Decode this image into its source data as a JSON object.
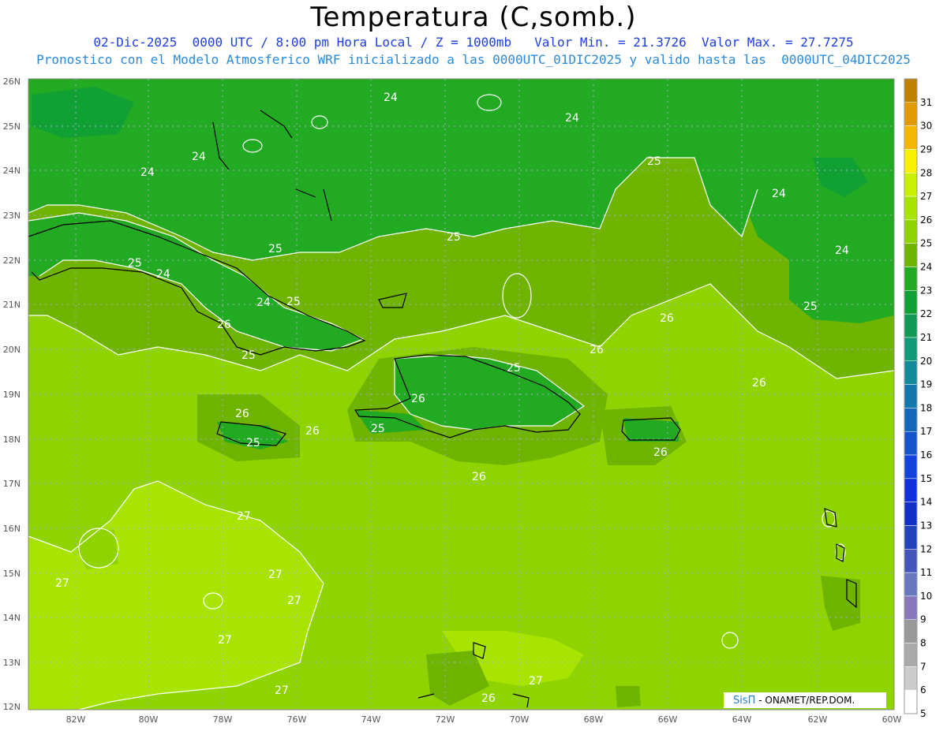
{
  "header": {
    "title": "Temperatura (C,somb.)",
    "line1": "02-Dic-2025  0000 UTC / 8:00 pm Hora Local / Z = 1000mb   Valor Min. = 21.3726  Valor Max. = 27.7275",
    "line2": "Pronostico con el Modelo Atmosferico WRF inicializado a las 0000UTC_01DIC2025 y valido hasta las  0000UTC_04DIC2025"
  },
  "axes": {
    "lat_labels": [
      "26N",
      "25N",
      "24N",
      "23N",
      "22N",
      "21N",
      "20N",
      "19N",
      "18N",
      "17N",
      "16N",
      "15N",
      "14N",
      "13N",
      "12N"
    ],
    "lon_labels": [
      "82W",
      "80W",
      "78W",
      "76W",
      "74W",
      "72W",
      "70W",
      "68W",
      "66W",
      "64W",
      "62W",
      "60W"
    ]
  },
  "colorbar": {
    "values": [
      "31",
      "30",
      "29",
      "28",
      "27",
      "26",
      "25",
      "24",
      "23",
      "22",
      "21",
      "20",
      "19",
      "18",
      "17",
      "16",
      "15",
      "14",
      "13",
      "12",
      "11",
      "10",
      "9",
      "8",
      "7",
      "6",
      "5"
    ],
    "colors": [
      "#c08000",
      "#e09a00",
      "#f5b800",
      "#f8f000",
      "#c8f000",
      "#a8e400",
      "#8fd400",
      "#6fb400",
      "#22aa22",
      "#11a033",
      "#129a55",
      "#129a77",
      "#138a99",
      "#1277aa",
      "#1466bb",
      "#1455cc",
      "#1244dd",
      "#1030dd",
      "#1030c8",
      "#2244bb",
      "#4455bb",
      "#6677bb",
      "#8877bb",
      "#999999",
      "#aaaaaa",
      "#cccccc",
      "#ffffff"
    ]
  },
  "contour_labels": [
    {
      "text": "24"
    },
    {
      "text": "24"
    },
    {
      "text": "24"
    },
    {
      "text": "24"
    },
    {
      "text": "24"
    },
    {
      "text": "24"
    },
    {
      "text": "24"
    },
    {
      "text": "24"
    },
    {
      "text": "25"
    },
    {
      "text": "25"
    },
    {
      "text": "25"
    },
    {
      "text": "25"
    },
    {
      "text": "25"
    },
    {
      "text": "25"
    },
    {
      "text": "25"
    },
    {
      "text": "25"
    },
    {
      "text": "25"
    },
    {
      "text": "25"
    },
    {
      "text": "26"
    },
    {
      "text": "26"
    },
    {
      "text": "26"
    },
    {
      "text": "26"
    },
    {
      "text": "26"
    },
    {
      "text": "26"
    },
    {
      "text": "26"
    },
    {
      "text": "26"
    },
    {
      "text": "26"
    },
    {
      "text": "26"
    },
    {
      "text": "27"
    },
    {
      "text": "27"
    },
    {
      "text": "27"
    },
    {
      "text": "27"
    },
    {
      "text": "27"
    },
    {
      "text": "27"
    },
    {
      "text": "27"
    }
  ],
  "credit": {
    "brand": "SisΠ",
    "text": " - ONAMET/REP.DOM."
  }
}
